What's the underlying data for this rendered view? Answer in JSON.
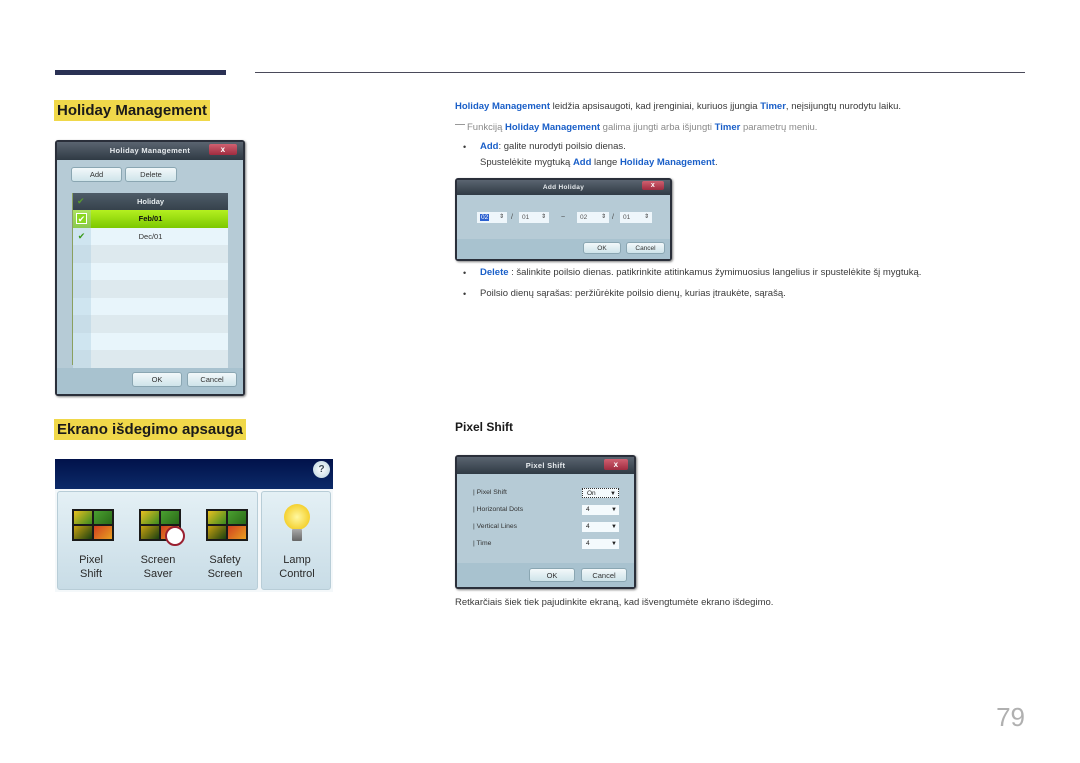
{
  "page_number": "79",
  "sections": {
    "holiday": {
      "heading": "Holiday Management",
      "intro": {
        "hl1": "Holiday Management",
        "t1": " leidžia apsisaugoti, kad įrenginiai, kuriuos įjungia ",
        "hl2": "Timer",
        "t2": ", neįsijungtų nurodytu laiku."
      },
      "note": {
        "prefix": "Funkciją ",
        "hl1": "Holiday Management",
        "t1": " galima įjungti arba išjungti ",
        "hl2": "Timer",
        "t2": " parametrų meniu."
      },
      "bullet_add": {
        "hl": "Add",
        "t": ": galite nurodyti poilsio dienas.",
        "line2_t1": "Spustelėkite mygtuką ",
        "line2_hl1": "Add",
        "line2_t2": " lange ",
        "line2_hl2": "Holiday Management",
        "line2_t3": "."
      },
      "bullet_delete": {
        "hl": "Delete",
        "t": " : šalinkite poilsio dienas. patikrinkite atitinkamus žymimuosius langelius ir spustelėkite šį mygtuką."
      },
      "bullet_list": {
        "t": "Poilsio dienų sąrašas: peržiūrėkite poilsio dienų, kurias įtraukėte, sąrašą."
      }
    },
    "burn": {
      "heading": "Ekrano išdegimo apsauga",
      "subheading": "Pixel Shift",
      "description": "Retkarčiais šiek tiek pajudinkite ekraną, kad išvengtumėte ekrano išdegimo."
    }
  },
  "holiday_dialog": {
    "title": "Holiday Management",
    "close": "x",
    "add_label": "Add",
    "delete_label": "Delete",
    "column_header": "Holiday",
    "rows": [
      {
        "date": "Feb/01",
        "checked": true,
        "selected": true
      },
      {
        "date": "Dec/01",
        "checked": true,
        "selected": false
      }
    ],
    "ok_label": "OK",
    "cancel_label": "Cancel"
  },
  "add_holiday_dialog": {
    "title": "Add Holiday",
    "close": "x",
    "start_month": "02",
    "start_day": "01",
    "range_sep": "~",
    "end_month": "02",
    "end_day": "01",
    "date_sep": "/",
    "ok_label": "OK",
    "cancel_label": "Cancel"
  },
  "pixel_shift_dialog": {
    "title": "Pixel Shift",
    "close": "x",
    "fields": [
      {
        "label": "| Pixel Shift",
        "value": "On"
      },
      {
        "label": "| Horizontal Dots",
        "value": "4"
      },
      {
        "label": "| Vertical Lines",
        "value": "4"
      },
      {
        "label": "| Time",
        "value": "4"
      }
    ],
    "ok_label": "OK",
    "cancel_label": "Cancel"
  },
  "burn_panel": {
    "help": "?",
    "items": [
      {
        "line1": "Pixel",
        "line2": "Shift"
      },
      {
        "line1": "Screen",
        "line2": "Saver"
      },
      {
        "line1": "Safety",
        "line2": "Screen"
      },
      {
        "line1": "Lamp",
        "line2": "Control"
      }
    ]
  }
}
